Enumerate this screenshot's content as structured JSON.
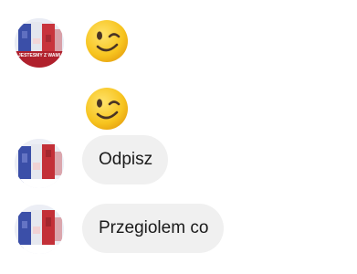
{
  "messages": [
    {
      "type": "emoji",
      "emoji": "winking-face-icon",
      "avatar": true,
      "avatar_caption": "JESTEŚMY Z WAMI"
    },
    {
      "type": "emoji",
      "emoji": "winking-face-icon",
      "avatar": false
    },
    {
      "type": "text",
      "text": "Odpisz",
      "avatar": true
    },
    {
      "type": "text",
      "text": "Przegiolem co",
      "avatar": true
    }
  ],
  "colors": {
    "background": "#ffffff",
    "bubble": "#f0f0f0",
    "text": "#1a1a1a",
    "emoji_face": "#f7c41f"
  }
}
